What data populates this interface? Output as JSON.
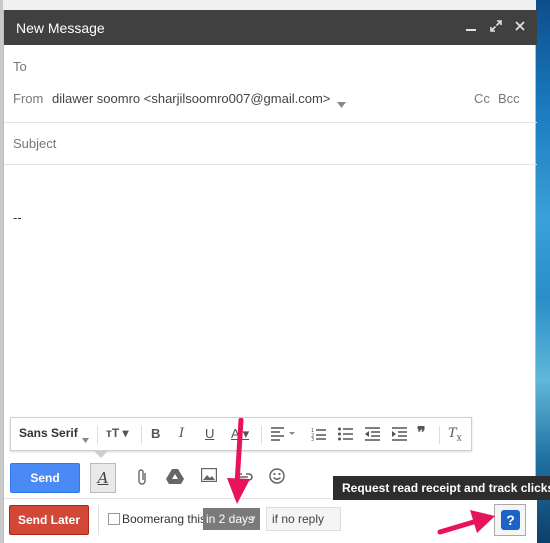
{
  "window": {
    "title": "New Message"
  },
  "header": {
    "to_label": "To",
    "from_label": "From",
    "from_value": "dilawer soomro <sharjilsoomro007@gmail.com>",
    "cc_label": "Cc",
    "bcc_label": "Bcc",
    "subject_placeholder": "Subject"
  },
  "body": {
    "signature": "--"
  },
  "format_toolbar": {
    "font_label": "Sans Serif"
  },
  "actions": {
    "send_label": "Send",
    "send_later_label": "Send Later",
    "boomerang_label": "Boomerang this",
    "days_value": "in 2 days",
    "reply_value": "if no reply"
  },
  "tooltip": {
    "text": "Request read receipt and track clicks"
  },
  "colors": {
    "titlebar": "#404040",
    "send": "#4a8af4",
    "send_later": "#d14836",
    "arrow": "#e8145a",
    "help": "#1c64c8"
  },
  "icons": [
    "minimize-icon",
    "expand-icon",
    "close-icon",
    "text-size-icon",
    "bold-icon",
    "italic-icon",
    "underline-icon",
    "text-color-icon",
    "align-icon",
    "numbered-list-icon",
    "bulleted-list-icon",
    "indent-less-icon",
    "indent-more-icon",
    "quote-icon",
    "remove-formatting-icon",
    "attach-icon",
    "drive-icon",
    "photo-icon",
    "link-icon",
    "emoji-icon",
    "question-icon"
  ]
}
